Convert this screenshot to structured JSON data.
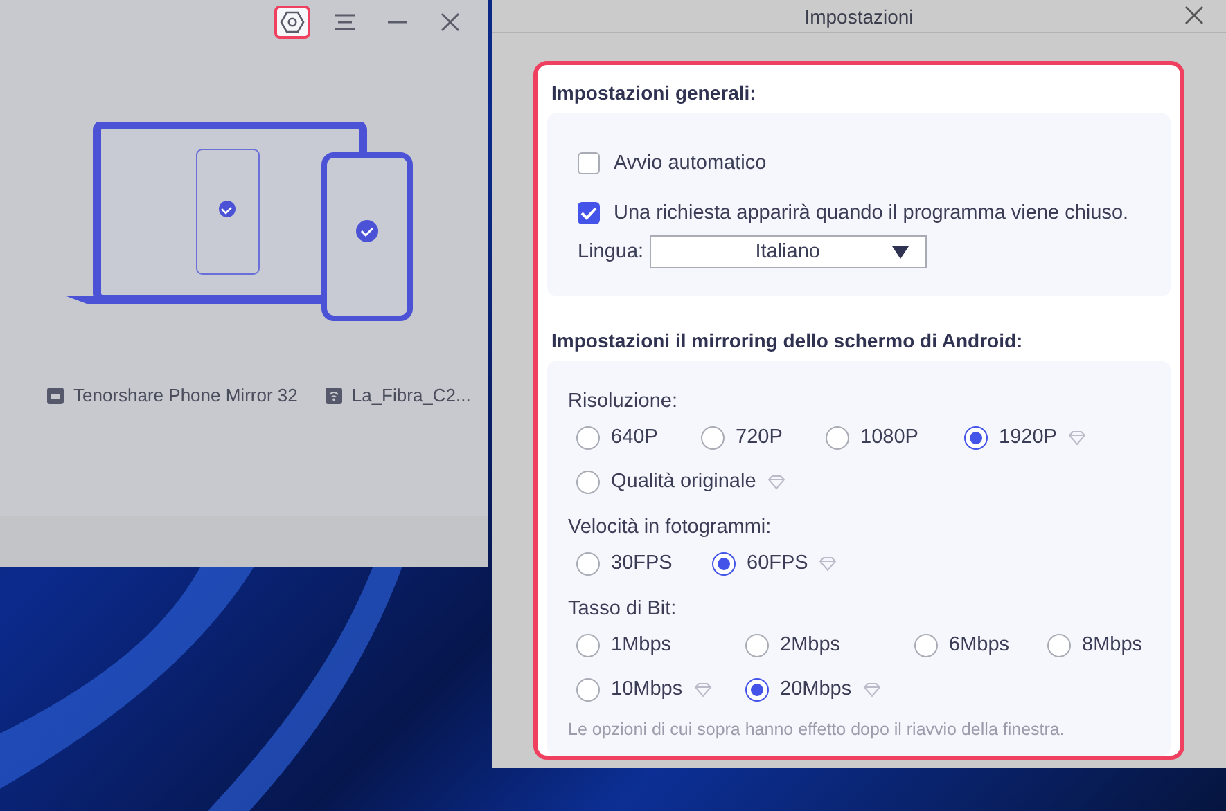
{
  "main_window": {
    "settings_highlighted": true,
    "devices": [
      {
        "kind": "tv",
        "label": "Tenorshare Phone Mirror 32"
      },
      {
        "kind": "wifi",
        "label": "La_Fibra_C2..."
      }
    ]
  },
  "settings_window": {
    "title": "Impostazioni",
    "highlighted": true,
    "general": {
      "title": "Impostazioni generali:",
      "options": [
        {
          "label": "Avvio automatico",
          "checked": false
        },
        {
          "label": "Una richiesta apparirà quando il programma viene chiuso.",
          "checked": true
        }
      ],
      "language": {
        "label": "Lingua:",
        "value": "Italiano"
      }
    },
    "mirroring": {
      "title": "Impostazioni il mirroring dello schermo di Android:",
      "groups": [
        {
          "label": "Risoluzione:",
          "options": [
            {
              "label": "640P",
              "selected": false,
              "premium": false
            },
            {
              "label": "720P",
              "selected": false,
              "premium": false
            },
            {
              "label": "1080P",
              "selected": false,
              "premium": false
            },
            {
              "label": "1920P",
              "selected": true,
              "premium": true
            },
            {
              "label": "Qualità originale",
              "selected": false,
              "premium": true
            }
          ]
        },
        {
          "label": "Velocità in fotogrammi:",
          "options": [
            {
              "label": "30FPS",
              "selected": false,
              "premium": false
            },
            {
              "label": "60FPS",
              "selected": true,
              "premium": true
            }
          ]
        },
        {
          "label": "Tasso di Bit:",
          "options": [
            {
              "label": "1Mbps",
              "selected": false,
              "premium": false
            },
            {
              "label": "2Mbps",
              "selected": false,
              "premium": false
            },
            {
              "label": "6Mbps",
              "selected": false,
              "premium": false
            },
            {
              "label": "8Mbps",
              "selected": false,
              "premium": false
            },
            {
              "label": "10Mbps",
              "selected": false,
              "premium": true
            },
            {
              "label": "20Mbps",
              "selected": true,
              "premium": true
            }
          ]
        }
      ],
      "note": "Le opzioni di cui sopra hanno effetto dopo il riavvio della finestra."
    }
  }
}
